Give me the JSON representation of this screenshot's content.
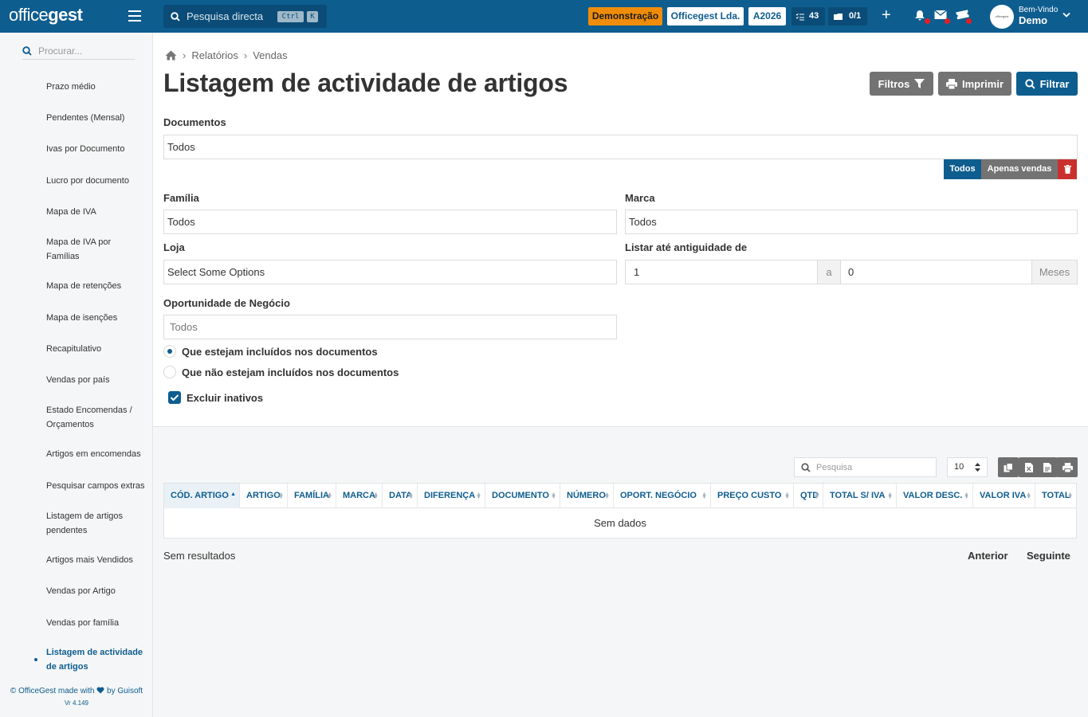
{
  "brand": {
    "logo_text_left": "office",
    "logo_text_right": "gest"
  },
  "topbar": {
    "search_placeholder": "Pesquisa directa",
    "kbd_ctrl": "Ctrl",
    "kbd_k": "K",
    "demo_badge": "Demonstração",
    "company": "Officegest Lda.",
    "year": "A2026",
    "tasks_count": "43",
    "docs_count": "0/1",
    "avatar_text": "officegest",
    "welcome": "Bem-Vindo",
    "user": "Demo"
  },
  "sidebar": {
    "search_placeholder": "Procurar...",
    "items": [
      {
        "label": "Prazo médio"
      },
      {
        "label": "Pendentes (Mensal)"
      },
      {
        "label": "Ivas por Documento"
      },
      {
        "label": "Lucro por documento"
      },
      {
        "label": "Mapa de IVA"
      },
      {
        "label": "Mapa de IVA por Famílias"
      },
      {
        "label": "Mapa de retenções"
      },
      {
        "label": "Mapa de isenções"
      },
      {
        "label": "Recapitulativo"
      },
      {
        "label": "Vendas por país"
      },
      {
        "label": "Estado Encomendas / Orçamentos"
      },
      {
        "label": "Artigos em encomendas"
      },
      {
        "label": "Pesquisar campos extras"
      },
      {
        "label": "Listagem de artigos pendentes"
      },
      {
        "label": "Artigos mais Vendidos"
      },
      {
        "label": "Vendas por Artigo"
      },
      {
        "label": "Vendas por família"
      },
      {
        "label": "Listagem de actividade de artigos"
      }
    ],
    "credits_left": "© OfficeGest made with",
    "credits_right": "by Guisoft",
    "version": "Vr 4.149"
  },
  "breadcrumb": {
    "level1": "Relatórios",
    "level2": "Vendas"
  },
  "page": {
    "title": "Listagem de actividade de artigos",
    "btn_filtros": "Filtros",
    "btn_imprimir": "Imprimir",
    "btn_filtrar": "Filtrar"
  },
  "form": {
    "documentos_label": "Documentos",
    "documentos_value": "Todos",
    "seg_todos": "Todos",
    "seg_apenas": "Apenas vendas",
    "familia_label": "Família",
    "familia_value": "Todos",
    "marca_label": "Marca",
    "marca_value": "Todos",
    "loja_label": "Loja",
    "loja_value": "Select Some Options",
    "antiguidade_label": "Listar até antiguidade de",
    "antiguidade_from": "1",
    "antiguidade_sep": "a",
    "antiguidade_to": "0",
    "antiguidade_unit": "Meses",
    "oportunidade_label": "Oportunidade de Negócio",
    "oportunidade_placeholder": "Todos",
    "radio_included": "Que estejam incluídos nos documentos",
    "radio_excluded": "Que não estejam incluídos nos documentos",
    "radio_selected": "included",
    "excluir_inativos": "Excluir inativos",
    "excluir_inativos_checked": true
  },
  "table": {
    "search_placeholder": "Pesquisa",
    "page_length": "10",
    "columns": [
      "CÓD. ARTIGO",
      "ARTIGO",
      "FAMÍLIA",
      "MARCA",
      "DATA",
      "DIFERENÇA",
      "DOCUMENTO",
      "NÚMERO",
      "OPORT. NEGÓCIO",
      "PREÇO CUSTO",
      "QTD",
      "TOTAL S/ IVA",
      "VALOR DESC.",
      "VALOR IVA",
      "TOTAL"
    ],
    "empty_text": "Sem dados",
    "info": "Sem resultados",
    "prev": "Anterior",
    "next": "Seguinte"
  },
  "colors": {
    "primary": "#0e5d8f",
    "demo": "#ef8c0a",
    "danger": "#c9302c",
    "grey_button": "#737373"
  }
}
